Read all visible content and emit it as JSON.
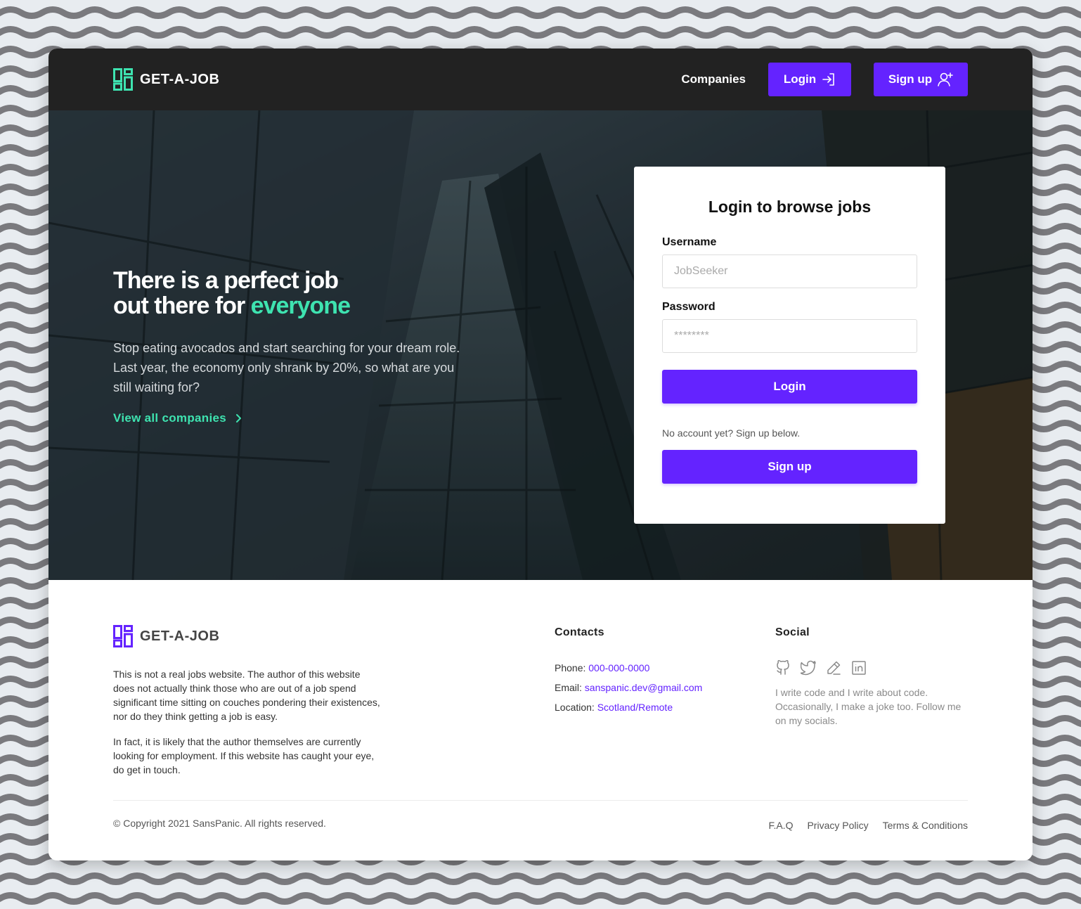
{
  "colors": {
    "accent_purple": "#6423ff",
    "accent_green": "#3ee3b0",
    "nav_bg": "#222222"
  },
  "header": {
    "brand": "GET-A-JOB",
    "logo_icon": "dashboard-grid-icon",
    "nav_link": "Companies",
    "login_label": "Login",
    "login_icon": "login-arrow-icon",
    "signup_label": "Sign up",
    "signup_icon": "user-plus-icon"
  },
  "hero": {
    "title_line1": "There is a perfect job",
    "title_line2_prefix": "out there for ",
    "title_line2_accent": "everyone",
    "description": "Stop eating avocados and start searching for your dream role. Last year, the economy only shrank by 20%, so what are you still waiting for?",
    "link_label": "View all companies",
    "link_icon": "chevron-right-icon"
  },
  "login_card": {
    "title": "Login to browse jobs",
    "username_label": "Username",
    "username_placeholder": "JobSeeker",
    "password_label": "Password",
    "password_placeholder": "********",
    "login_button": "Login",
    "note": "No account yet? Sign up below.",
    "signup_button": "Sign up"
  },
  "footer": {
    "brand": "GET-A-JOB",
    "about_p1": "This is not a real jobs website. The author of this website does not actually think those who are out of a job spend significant time sitting on couches pondering their existences, nor do they think getting a job is easy.",
    "about_p2": "In fact, it is likely that the author themselves are currently looking for employment. If this website has caught your eye, do get in touch.",
    "contacts": {
      "heading": "Contacts",
      "phone_label": "Phone: ",
      "phone": "000-000-0000",
      "email_label": "Email: ",
      "email": "sanspanic.dev@gmail.com",
      "location_label": "Location: ",
      "location": "Scotland/Remote"
    },
    "social": {
      "heading": "Social",
      "icons": [
        "github-icon",
        "twitter-icon",
        "pencil-icon",
        "linkedin-icon"
      ],
      "text": "I write code and I write about code. Occasionally, I make a joke too. Follow me on my socials."
    },
    "copyright": "© Copyright 2021 SansPanic. All rights reserved.",
    "links": [
      "F.A.Q",
      "Privacy Policy",
      "Terms & Conditions"
    ]
  }
}
